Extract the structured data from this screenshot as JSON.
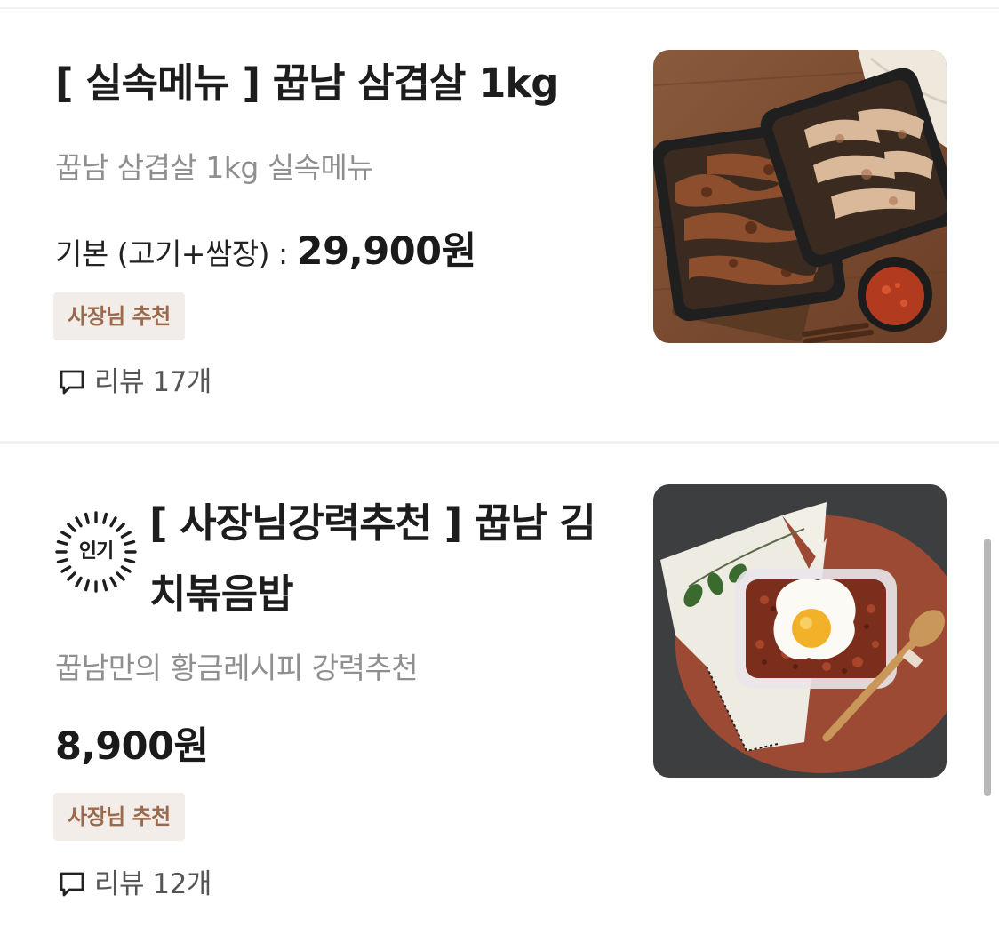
{
  "items": [
    {
      "title": "[ 실속메뉴 ]  꿉남 삼겹살 1kg",
      "description": "꿉남 삼겹살 1kg 실속메뉴",
      "price_option": "기본 (고기+쌈장) : ",
      "price": "29,900원",
      "tag": "사장님 추천",
      "review": "리뷰 17개",
      "image_alt": "grilled pork belly in two black containers with sauce",
      "badge": null
    },
    {
      "title": "[ 사장님강력추천 ] 꿉남 김치볶음밥",
      "description": "꿉남만의 황금레시피 강력추천",
      "price_option": "",
      "price": "8,900원",
      "tag": "사장님 추천",
      "review": "리뷰 12개",
      "image_alt": "kimchi fried rice with fried egg",
      "badge": "인기"
    }
  ],
  "icons": {
    "review": "speech-bubble-icon",
    "popular": "burst-badge-icon"
  },
  "colors": {
    "tag_bg": "#f2ede8",
    "tag_text": "#9b6a4c",
    "price": "#1a1a1a",
    "description": "#8f8f8f"
  }
}
